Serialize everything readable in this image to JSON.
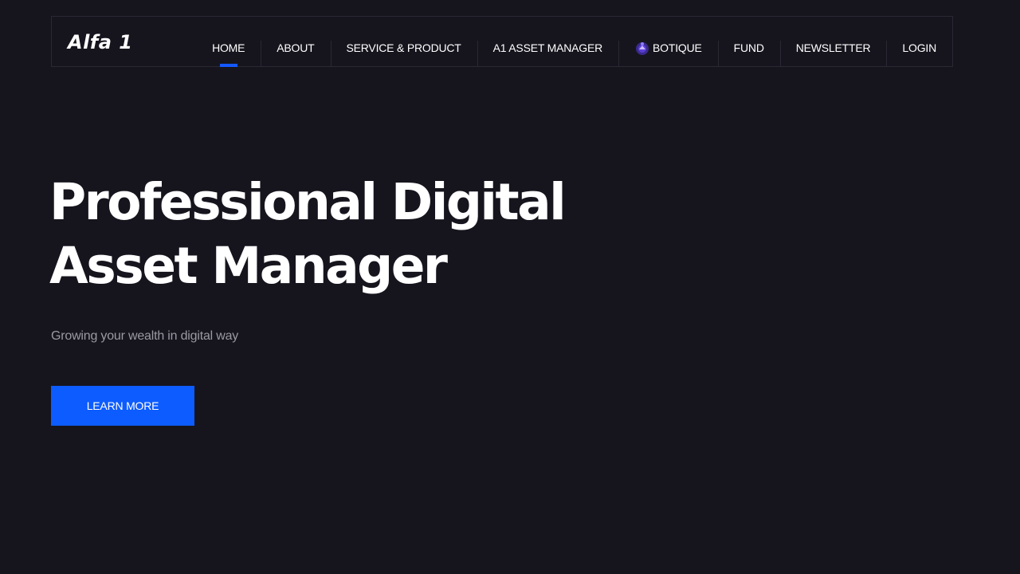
{
  "brand": {
    "logo_text": "Alfa 1"
  },
  "nav": {
    "items": [
      {
        "label": "HOME",
        "active": true
      },
      {
        "label": "ABOUT"
      },
      {
        "label": "SERVICE & PRODUCT"
      },
      {
        "label": "A1 ASSET MANAGER"
      },
      {
        "label": "BOTIQUE",
        "icon": "boutique-icon"
      },
      {
        "label": "FUND"
      },
      {
        "label": "NEWSLETTER"
      },
      {
        "label": "LOGIN"
      }
    ]
  },
  "hero": {
    "title_line1": "Professional Digital",
    "title_line2": "Asset Manager",
    "subtitle": "Growing your wealth in digital way",
    "cta_label": "LEARN MORE"
  },
  "colors": {
    "background": "#16151e",
    "accent": "#0c5cff",
    "border": "#2a2933",
    "muted_text": "#9b9aa3"
  }
}
